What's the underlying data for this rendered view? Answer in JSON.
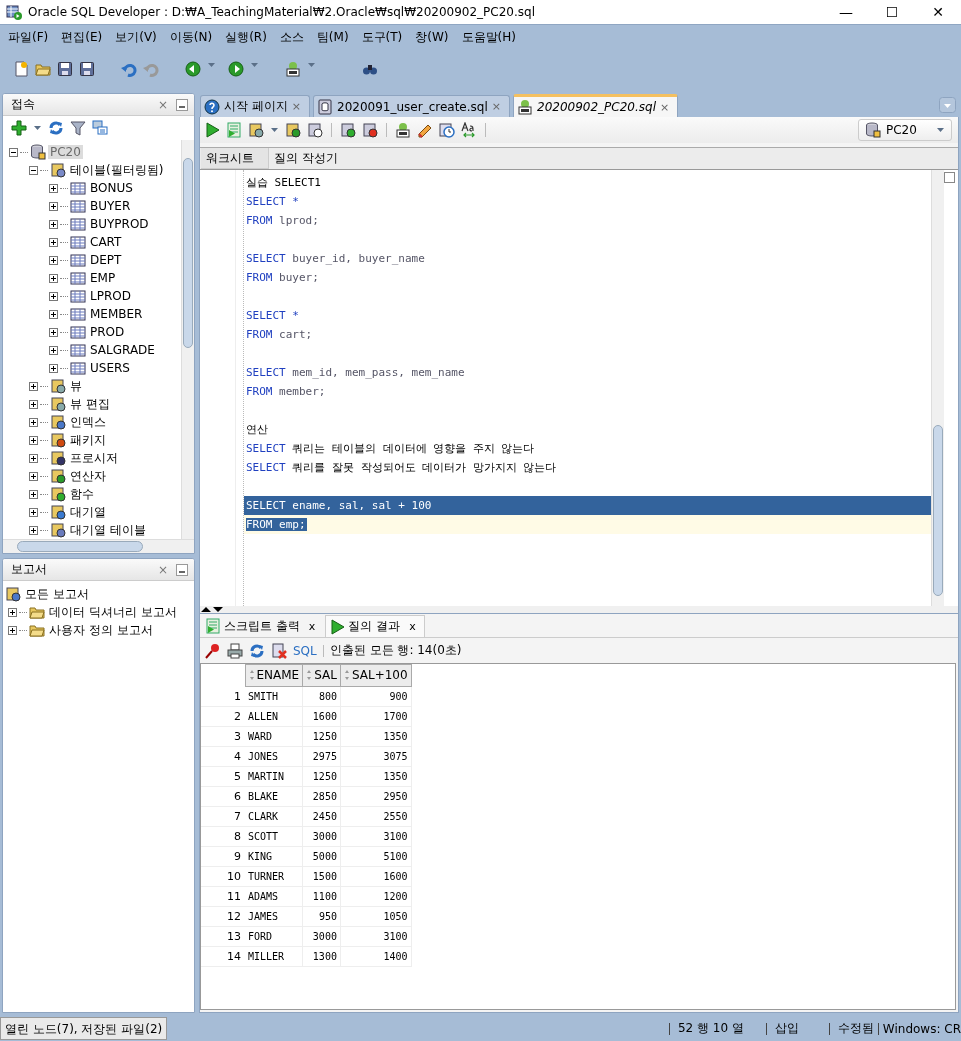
{
  "window": {
    "title": "Oracle SQL Developer : D:₩A_TeachingMaterial₩2.Oracle₩sql₩20200902_PC20.sql",
    "controls": [
      "—",
      "☐",
      "✕"
    ]
  },
  "menu": [
    "파일(F)",
    "편집(E)",
    "보기(V)",
    "이동(N)",
    "실행(R)",
    "소스",
    "팀(M)",
    "도구(T)",
    "창(W)",
    "도움말(H)"
  ],
  "connections_panel": {
    "title": "접속",
    "close": "×",
    "tree": [
      {
        "label": "PC20",
        "kind": "connection",
        "expanded": true,
        "selected": true,
        "children": [
          {
            "label": "테이블(필터링됨)",
            "kind": "tables",
            "expanded": true,
            "selected": false,
            "children": [
              {
                "label": "BONUS",
                "kind": "table",
                "expanded": false,
                "selected": false
              },
              {
                "label": "BUYER",
                "kind": "table",
                "expanded": false,
                "selected": false
              },
              {
                "label": "BUYPROD",
                "kind": "table",
                "expanded": false,
                "selected": false
              },
              {
                "label": "CART",
                "kind": "table",
                "expanded": false,
                "selected": false
              },
              {
                "label": "DEPT",
                "kind": "table",
                "expanded": false,
                "selected": false
              },
              {
                "label": "EMP",
                "kind": "table",
                "expanded": false,
                "selected": false
              },
              {
                "label": "LPROD",
                "kind": "table",
                "expanded": false,
                "selected": false
              },
              {
                "label": "MEMBER",
                "kind": "table",
                "expanded": false,
                "selected": false
              },
              {
                "label": "PROD",
                "kind": "table",
                "expanded": false,
                "selected": false
              },
              {
                "label": "SALGRADE",
                "kind": "table",
                "expanded": false,
                "selected": false
              },
              {
                "label": "USERS",
                "kind": "table",
                "expanded": false,
                "selected": false
              }
            ]
          },
          {
            "label": "뷰",
            "kind": "views",
            "expanded": false,
            "selected": false
          },
          {
            "label": "뷰 편집",
            "kind": "views",
            "expanded": false,
            "selected": false
          },
          {
            "label": "인덱스",
            "kind": "indexes",
            "expanded": false,
            "selected": false
          },
          {
            "label": "패키지",
            "kind": "packages",
            "expanded": false,
            "selected": false
          },
          {
            "label": "프로시저",
            "kind": "procedures",
            "expanded": false,
            "selected": false
          },
          {
            "label": "연산자",
            "kind": "operators",
            "expanded": false,
            "selected": false
          },
          {
            "label": "함수",
            "kind": "functions",
            "expanded": false,
            "selected": false
          },
          {
            "label": "대기열",
            "kind": "queues",
            "expanded": false,
            "selected": false
          },
          {
            "label": "대기열 테이블",
            "kind": "queue-tables",
            "expanded": false,
            "selected": false
          }
        ]
      }
    ]
  },
  "reports_panel": {
    "title": "보고서",
    "close": "×",
    "root": {
      "label": "모든 보고서"
    },
    "items": [
      {
        "label": "데이터 딕셔너리 보고서",
        "expanded": false,
        "selected": false
      },
      {
        "label": "사용자 정의 보고서",
        "expanded": false,
        "selected": false
      }
    ]
  },
  "document_tabs": [
    {
      "label": "시작 페이지",
      "kind": "help",
      "selected": false,
      "close": "×"
    },
    {
      "label": "2020091_user_create.sql",
      "kind": "file",
      "selected": false,
      "close": "×"
    },
    {
      "label": "20200902_PC20.sql",
      "kind": "worksheet",
      "selected": true,
      "close": "×"
    }
  ],
  "connection_selector": {
    "value": "PC20"
  },
  "worksheet_tabs": [
    {
      "label": "워크시트",
      "selected": true
    },
    {
      "label": "질의 작성기",
      "selected": false
    }
  ],
  "code": {
    "lines": [
      {
        "kind": "text",
        "segments": [
          {
            "text": "실습 SELECT1",
            "kind": "plain"
          }
        ],
        "selected": false,
        "current": false
      },
      {
        "kind": "text",
        "segments": [
          {
            "text": "SELECT *",
            "kind": "keyword"
          }
        ],
        "selected": false,
        "current": false
      },
      {
        "kind": "text",
        "segments": [
          {
            "text": "FROM",
            "kind": "keyword"
          },
          {
            "text": " lprod;",
            "kind": "ident"
          }
        ],
        "selected": false,
        "current": false
      },
      {
        "kind": "blank",
        "selected": false,
        "current": false
      },
      {
        "kind": "text",
        "segments": [
          {
            "text": "SELECT",
            "kind": "keyword"
          },
          {
            "text": " buyer_id, buyer_name",
            "kind": "ident"
          }
        ],
        "selected": false,
        "current": false
      },
      {
        "kind": "text",
        "segments": [
          {
            "text": "FROM",
            "kind": "keyword"
          },
          {
            "text": " buyer;",
            "kind": "ident"
          }
        ],
        "selected": false,
        "current": false
      },
      {
        "kind": "blank",
        "selected": false,
        "current": false
      },
      {
        "kind": "text",
        "segments": [
          {
            "text": "SELECT *",
            "kind": "keyword"
          }
        ],
        "selected": false,
        "current": false
      },
      {
        "kind": "text",
        "segments": [
          {
            "text": "FROM",
            "kind": "keyword"
          },
          {
            "text": " cart;",
            "kind": "ident"
          }
        ],
        "selected": false,
        "current": false
      },
      {
        "kind": "blank",
        "selected": false,
        "current": false
      },
      {
        "kind": "text",
        "segments": [
          {
            "text": "SELECT",
            "kind": "keyword"
          },
          {
            "text": " mem_id, mem_pass, mem_name",
            "kind": "ident"
          }
        ],
        "selected": false,
        "current": false
      },
      {
        "kind": "text",
        "segments": [
          {
            "text": "FROM",
            "kind": "keyword"
          },
          {
            "text": " member;",
            "kind": "ident"
          }
        ],
        "selected": false,
        "current": false
      },
      {
        "kind": "blank",
        "selected": false,
        "current": false
      },
      {
        "kind": "text",
        "segments": [
          {
            "text": "연산",
            "kind": "plain"
          }
        ],
        "selected": false,
        "current": false
      },
      {
        "kind": "text",
        "segments": [
          {
            "text": "SELECT",
            "kind": "keyword"
          },
          {
            "text": " 쿼리는 테이블의 데이터에 영향을 주지 않는다",
            "kind": "plain"
          }
        ],
        "selected": false,
        "current": false
      },
      {
        "kind": "text",
        "segments": [
          {
            "text": "SELECT",
            "kind": "keyword"
          },
          {
            "text": " 쿼리를 잘못 작성되어도 데이터가 망가지지 않는다",
            "kind": "plain"
          }
        ],
        "selected": false,
        "current": false
      },
      {
        "kind": "blank",
        "selected": false,
        "current": false
      },
      {
        "kind": "text",
        "segments": [
          {
            "text": "SELECT ename, sal, sal + 100"
          }
        ],
        "selected": true,
        "current": false
      },
      {
        "kind": "text",
        "segments": [
          {
            "text": "FROM emp;"
          }
        ],
        "selected": true,
        "current": true
      }
    ]
  },
  "result_tabs": [
    {
      "label": "스크립트 출력",
      "kind": "script",
      "selected": false,
      "close": "x"
    },
    {
      "label": "질의 결과",
      "kind": "run",
      "selected": true,
      "close": "x"
    }
  ],
  "result_toolbar": {
    "sql_link": "SQL",
    "status": "인출된 모든 행: 14(0초)"
  },
  "grid": {
    "columns": [
      "ENAME",
      "SAL",
      "SAL+100"
    ],
    "rows": [
      {
        "number": "1",
        "cells": [
          "SMITH",
          "800",
          "900"
        ]
      },
      {
        "number": "2",
        "cells": [
          "ALLEN",
          "1600",
          "1700"
        ]
      },
      {
        "number": "3",
        "cells": [
          "WARD",
          "1250",
          "1350"
        ]
      },
      {
        "number": "4",
        "cells": [
          "JONES",
          "2975",
          "3075"
        ]
      },
      {
        "number": "5",
        "cells": [
          "MARTIN",
          "1250",
          "1350"
        ]
      },
      {
        "number": "6",
        "cells": [
          "BLAKE",
          "2850",
          "2950"
        ]
      },
      {
        "number": "7",
        "cells": [
          "CLARK",
          "2450",
          "2550"
        ]
      },
      {
        "number": "8",
        "cells": [
          "SCOTT",
          "3000",
          "3100"
        ]
      },
      {
        "number": "9",
        "cells": [
          "KING",
          "5000",
          "5100"
        ]
      },
      {
        "number": "10",
        "cells": [
          "TURNER",
          "1500",
          "1600"
        ]
      },
      {
        "number": "11",
        "cells": [
          "ADAMS",
          "1100",
          "1200"
        ]
      },
      {
        "number": "12",
        "cells": [
          "JAMES",
          "950",
          "1050"
        ]
      },
      {
        "number": "13",
        "cells": [
          "FORD",
          "3000",
          "3100"
        ]
      },
      {
        "number": "14",
        "cells": [
          "MILLER",
          "1300",
          "1400"
        ]
      }
    ]
  },
  "status_bar": {
    "left": "열린 노드(7), 저장된 파일(2)",
    "position": "52 행 10 열",
    "mode": "삽입",
    "state": "수정됨",
    "line_ending": "Windows: CR"
  }
}
